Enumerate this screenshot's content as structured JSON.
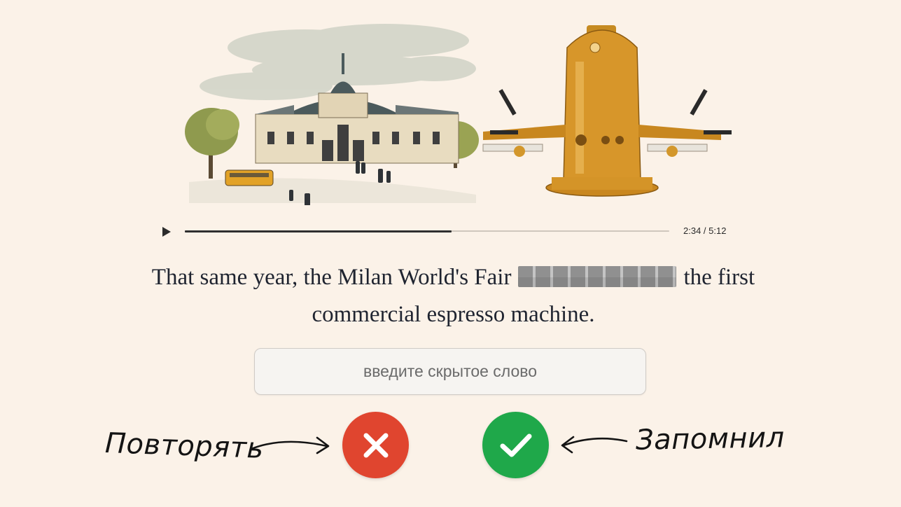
{
  "player": {
    "progress": 0.55,
    "time_display": "2:34 / 5:12"
  },
  "sentence": {
    "before": "That same year, the Milan World's Fair",
    "after": "the first commercial espresso machine."
  },
  "answer": {
    "placeholder": "введите скрытое слово",
    "value": ""
  },
  "actions": {
    "repeat_label": "Повторять",
    "remember_label": "Запомнил",
    "repeat_color": "#e0452f",
    "remember_color": "#1fa84a"
  },
  "colors": {
    "background": "#fbf2e8",
    "text": "#1f2430"
  }
}
